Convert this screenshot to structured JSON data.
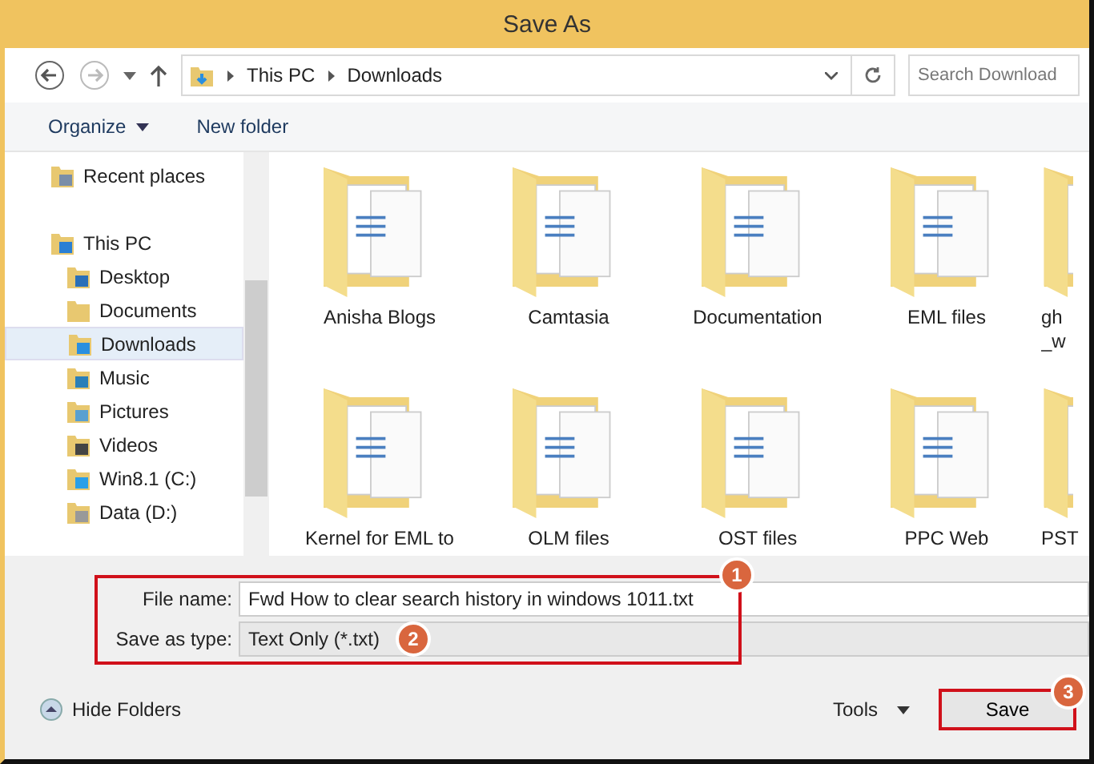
{
  "window": {
    "title": "Save As"
  },
  "address": {
    "segments": [
      "This PC",
      "Downloads"
    ],
    "search_placeholder": "Search Download"
  },
  "toolbar": {
    "organize": "Organize",
    "new_folder": "New folder"
  },
  "sidebar": {
    "items": [
      {
        "label": "Recent places",
        "kind": "recent",
        "selected": false
      },
      {
        "label": "This PC",
        "kind": "pc",
        "selected": false,
        "children": [
          {
            "label": "Desktop",
            "kind": "desktop",
            "selected": false
          },
          {
            "label": "Documents",
            "kind": "documents",
            "selected": false
          },
          {
            "label": "Downloads",
            "kind": "downloads",
            "selected": true
          },
          {
            "label": "Music",
            "kind": "music",
            "selected": false
          },
          {
            "label": "Pictures",
            "kind": "pictures",
            "selected": false
          },
          {
            "label": "Videos",
            "kind": "videos",
            "selected": false
          },
          {
            "label": "Win8.1 (C:)",
            "kind": "system-drive",
            "selected": false
          },
          {
            "label": "Data (D:)",
            "kind": "drive",
            "selected": false
          }
        ]
      }
    ]
  },
  "folders": [
    {
      "name": [
        "Anisha Blogs"
      ]
    },
    {
      "name": [
        "Camtasia"
      ]
    },
    {
      "name": [
        "Documentation"
      ]
    },
    {
      "name": [
        "EML files"
      ]
    },
    {
      "name": [
        "gh",
        "_w"
      ]
    },
    {
      "name": [
        "Kernel for EML to"
      ]
    },
    {
      "name": [
        "OLM files"
      ]
    },
    {
      "name": [
        "OST files"
      ]
    },
    {
      "name": [
        "PPC Web"
      ]
    },
    {
      "name": [
        "PST"
      ]
    }
  ],
  "form": {
    "file_name_label": "File name:",
    "file_name": "Fwd How to clear search history in windows 1011.txt",
    "type_label": "Save as type:",
    "type": "Text Only (*.txt)"
  },
  "footer": {
    "hide_folders": "Hide Folders",
    "tools": "Tools",
    "save": "Save"
  },
  "callouts": [
    "1",
    "2",
    "3"
  ]
}
